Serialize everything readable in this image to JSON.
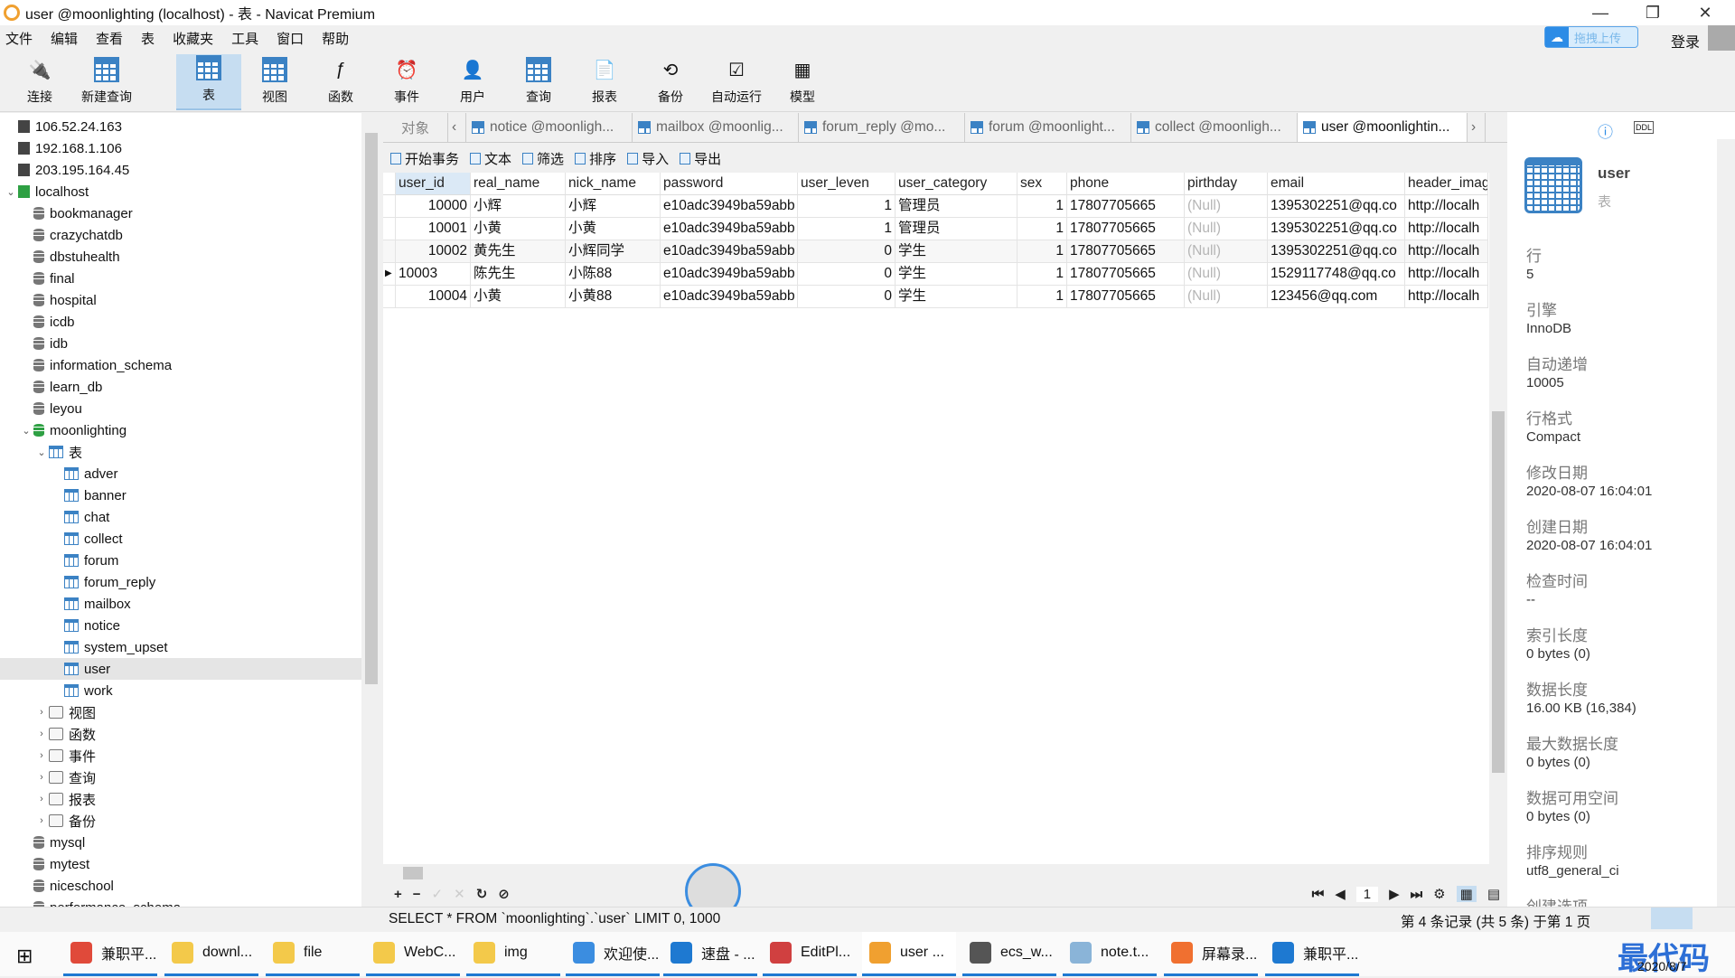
{
  "window": {
    "title": "user @moonlighting (localhost) - 表 - Navicat Premium",
    "upload": "拖拽上传",
    "login": "登录"
  },
  "menu": [
    "文件",
    "编辑",
    "查看",
    "表",
    "收藏夹",
    "工具",
    "窗口",
    "帮助"
  ],
  "toolbar": [
    {
      "label": "连接",
      "icon": "plug-icon"
    },
    {
      "label": "新建查询",
      "icon": "new-query-icon"
    },
    {
      "label": "表",
      "icon": "table-icon",
      "active": true
    },
    {
      "label": "视图",
      "icon": "view-icon"
    },
    {
      "label": "函数",
      "icon": "function-icon"
    },
    {
      "label": "事件",
      "icon": "clock-icon"
    },
    {
      "label": "用户",
      "icon": "user-icon"
    },
    {
      "label": "查询",
      "icon": "query-icon"
    },
    {
      "label": "报表",
      "icon": "report-icon"
    },
    {
      "label": "备份",
      "icon": "backup-icon"
    },
    {
      "label": "自动运行",
      "icon": "autorun-icon"
    },
    {
      "label": "模型",
      "icon": "model-icon"
    }
  ],
  "tree": [
    {
      "label": "106.52.24.163",
      "type": "srv",
      "lvl": 0
    },
    {
      "label": "192.168.1.106",
      "type": "srv",
      "lvl": 0
    },
    {
      "label": "203.195.164.45",
      "type": "srv",
      "lvl": 0
    },
    {
      "label": "localhost",
      "type": "srvg",
      "lvl": 0,
      "open": true
    },
    {
      "label": "bookmanager",
      "type": "db",
      "lvl": 1
    },
    {
      "label": "crazychatdb",
      "type": "db",
      "lvl": 1
    },
    {
      "label": "dbstuhealth",
      "type": "db",
      "lvl": 1
    },
    {
      "label": "final",
      "type": "db",
      "lvl": 1
    },
    {
      "label": "hospital",
      "type": "db",
      "lvl": 1
    },
    {
      "label": "icdb",
      "type": "db",
      "lvl": 1
    },
    {
      "label": "idb",
      "type": "db",
      "lvl": 1
    },
    {
      "label": "information_schema",
      "type": "db",
      "lvl": 1
    },
    {
      "label": "learn_db",
      "type": "db",
      "lvl": 1
    },
    {
      "label": "leyou",
      "type": "db",
      "lvl": 1
    },
    {
      "label": "moonlighting",
      "type": "dbg",
      "lvl": 1,
      "open": true
    },
    {
      "label": "表",
      "type": "tbl",
      "lvl": 2,
      "open": true
    },
    {
      "label": "adver",
      "type": "tbl",
      "lvl": 3
    },
    {
      "label": "banner",
      "type": "tbl",
      "lvl": 3
    },
    {
      "label": "chat",
      "type": "tbl",
      "lvl": 3
    },
    {
      "label": "collect",
      "type": "tbl",
      "lvl": 3
    },
    {
      "label": "forum",
      "type": "tbl",
      "lvl": 3
    },
    {
      "label": "forum_reply",
      "type": "tbl",
      "lvl": 3
    },
    {
      "label": "mailbox",
      "type": "tbl",
      "lvl": 3
    },
    {
      "label": "notice",
      "type": "tbl",
      "lvl": 3
    },
    {
      "label": "system_upset",
      "type": "tbl",
      "lvl": 3
    },
    {
      "label": "user",
      "type": "tbl",
      "lvl": 3,
      "selected": true
    },
    {
      "label": "work",
      "type": "tbl",
      "lvl": 3
    },
    {
      "label": "视图",
      "type": "misc",
      "lvl": 2,
      "closed": true
    },
    {
      "label": "函数",
      "type": "misc",
      "lvl": 2,
      "closed": true
    },
    {
      "label": "事件",
      "type": "misc",
      "lvl": 2,
      "closed": true
    },
    {
      "label": "查询",
      "type": "misc",
      "lvl": 2,
      "closed": true
    },
    {
      "label": "报表",
      "type": "misc",
      "lvl": 2,
      "closed": true
    },
    {
      "label": "备份",
      "type": "misc",
      "lvl": 2,
      "closed": true
    },
    {
      "label": "mysql",
      "type": "db",
      "lvl": 1
    },
    {
      "label": "mytest",
      "type": "db",
      "lvl": 1
    },
    {
      "label": "niceschool",
      "type": "db",
      "lvl": 1
    },
    {
      "label": "performance_schema",
      "type": "db",
      "lvl": 1
    }
  ],
  "tabs": {
    "objects": "对象",
    "items": [
      {
        "label": "notice @moonligh..."
      },
      {
        "label": "mailbox @moonlig..."
      },
      {
        "label": "forum_reply @mo..."
      },
      {
        "label": "forum @moonlight..."
      },
      {
        "label": "collect @moonligh..."
      },
      {
        "label": "user @moonlightin...",
        "active": true
      }
    ]
  },
  "data_toolbar": [
    "开始事务",
    "文本",
    "筛选",
    "排序",
    "导入",
    "导出"
  ],
  "grid": {
    "columns": [
      "user_id",
      "real_name",
      "nick_name",
      "password",
      "user_leven",
      "user_category",
      "sex",
      "phone",
      "pirthday",
      "email",
      "header_imag"
    ],
    "rows": [
      [
        "10000",
        "小辉",
        "小辉",
        "e10adc3949ba59abb",
        "1",
        "管理员",
        "1",
        "17807705665",
        "(Null)",
        "1395302251@qq.co",
        "http://localh"
      ],
      [
        "10001",
        "小黄",
        "小黄",
        "e10adc3949ba59abb",
        "1",
        "管理员",
        "1",
        "17807705665",
        "(Null)",
        "1395302251@qq.co",
        "http://localh"
      ],
      [
        "10002",
        "黄先生",
        "小辉同学",
        "e10adc3949ba59abb",
        "0",
        "学生",
        "1",
        "17807705665",
        "(Null)",
        "1395302251@qq.co",
        "http://localh"
      ],
      [
        "10003",
        "陈先生",
        "小陈88",
        "e10adc3949ba59abb",
        "0",
        "学生",
        "1",
        "17807705665",
        "(Null)",
        "1529117748@qq.co",
        "http://localh"
      ],
      [
        "10004",
        "小黄",
        "小黄88",
        "e10adc3949ba59abb",
        "0",
        "学生",
        "1",
        "17807705665",
        "(Null)",
        "123456@qq.com",
        "http://localh"
      ]
    ],
    "current_row": 3,
    "page": "1"
  },
  "status": {
    "sql": "SELECT * FROM `moonlighting`.`user` LIMIT 0, 1000",
    "record": "第 4 条记录 (共 5 条) 于第 1 页"
  },
  "info": {
    "name": "user",
    "type": "表",
    "props": [
      [
        "行",
        "5"
      ],
      [
        "引擎",
        "InnoDB"
      ],
      [
        "自动递增",
        "10005"
      ],
      [
        "行格式",
        "Compact"
      ],
      [
        "修改日期",
        "2020-08-07 16:04:01"
      ],
      [
        "创建日期",
        "2020-08-07 16:04:01"
      ],
      [
        "检查时间",
        "--"
      ],
      [
        "索引长度",
        "0 bytes (0)"
      ],
      [
        "数据长度",
        "16.00 KB (16,384)"
      ],
      [
        "最大数据长度",
        "0 bytes (0)"
      ],
      [
        "数据可用空间",
        "0 bytes (0)"
      ],
      [
        "排序规则",
        "utf8_general_ci"
      ],
      [
        "创建选项",
        ""
      ]
    ]
  },
  "taskbar": {
    "items": [
      {
        "label": "兼职平...",
        "color": "#e04a3a"
      },
      {
        "label": "downl...",
        "color": "#f3c94a"
      },
      {
        "label": "file",
        "color": "#f3c94a"
      },
      {
        "label": "WebC...",
        "color": "#f3c94a"
      },
      {
        "label": "img",
        "color": "#f3c94a"
      },
      {
        "label": "欢迎使...",
        "color": "#3b8de0"
      },
      {
        "label": "速盘 - ...",
        "color": "#1e79d1"
      },
      {
        "label": "EditPl...",
        "color": "#d04040"
      },
      {
        "label": "user ...",
        "color": "#f0a030",
        "active": true
      },
      {
        "label": "ecs_w...",
        "color": "#555"
      },
      {
        "label": "note.t...",
        "color": "#8ab4d8"
      },
      {
        "label": "屏幕录...",
        "color": "#f07030"
      },
      {
        "label": "兼职平...",
        "color": "#1e79d1"
      }
    ],
    "date": "2020/8/7",
    "watermark": "最代码"
  }
}
